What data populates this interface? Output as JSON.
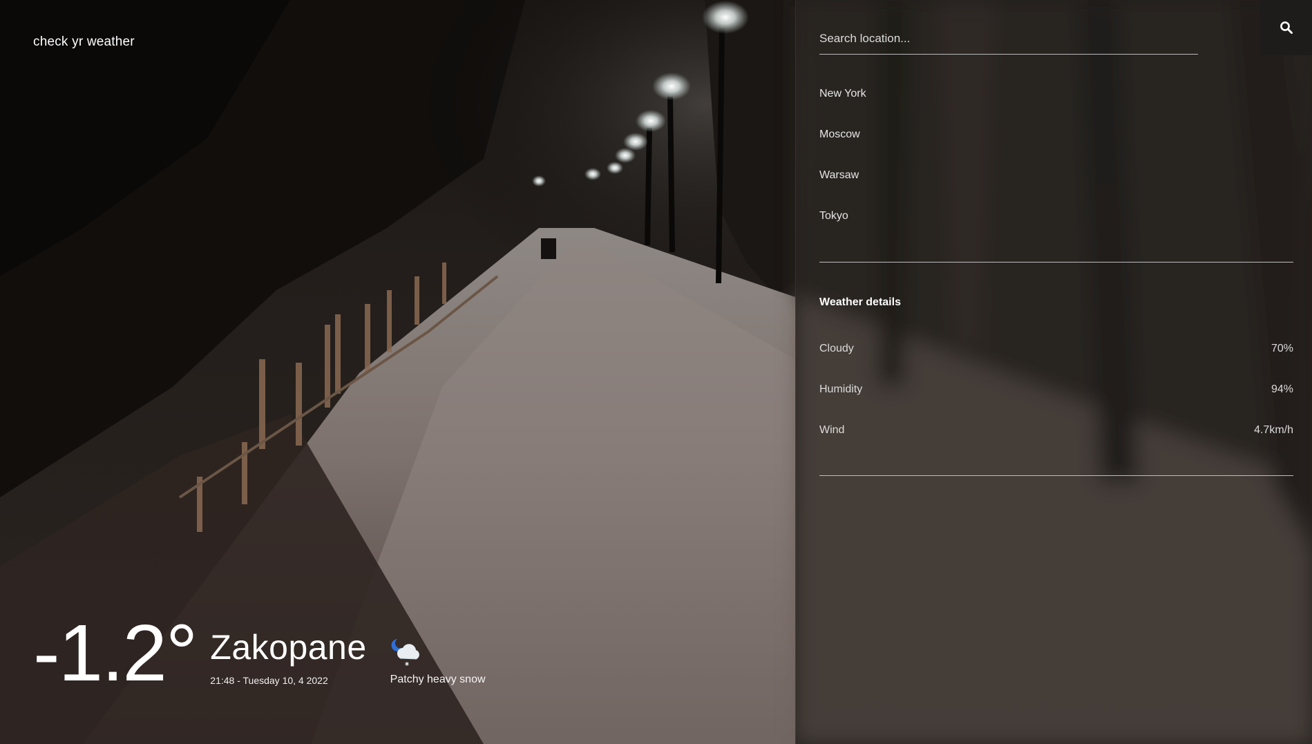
{
  "app": {
    "brand": "check yr weather"
  },
  "current": {
    "temperature": "-1.2°",
    "city": "Zakopane",
    "datetime": "21:48 - Tuesday 10, 4 2022",
    "condition": "Patchy heavy snow",
    "condition_icon": "night-cloud-snow-icon"
  },
  "search": {
    "placeholder": "Search location...",
    "button_icon": "search-icon"
  },
  "locations": [
    "New York",
    "Moscow",
    "Warsaw",
    "Tokyo"
  ],
  "details": {
    "title": "Weather details",
    "rows": [
      {
        "label": "Cloudy",
        "value": "70%"
      },
      {
        "label": "Humidity",
        "value": "94%"
      },
      {
        "label": "Wind",
        "value": "4.7km/h"
      }
    ]
  },
  "colors": {
    "panel_bg": "#282421",
    "search_button_bg": "#1e1c1b",
    "divider": "#bfbfbf",
    "text": "#ffffff"
  }
}
